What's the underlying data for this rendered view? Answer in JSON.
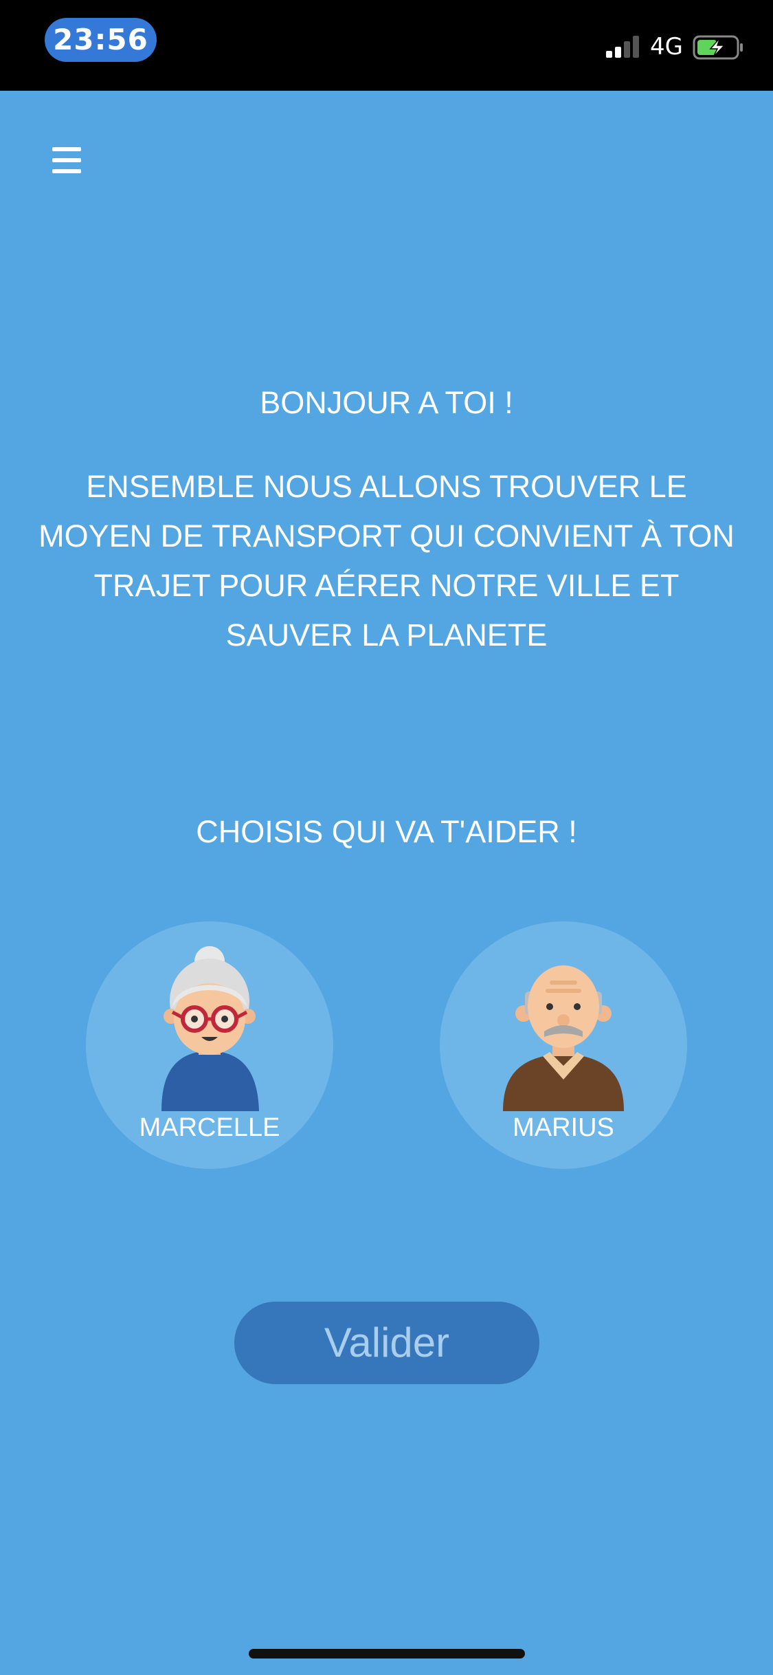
{
  "status_bar": {
    "time": "23:56",
    "network": "4G",
    "icons": [
      "signal-icon",
      "battery-charging-icon"
    ]
  },
  "menu": {
    "icon": "hamburger-menu-icon"
  },
  "main": {
    "greeting": "BONJOUR A TOI !",
    "intro": "ENSEMBLE NOUS ALLONS TROUVER LE MOYEN DE TRANSPORT QUI CONVIENT À TON TRAJET POUR AÉRER NOTRE VILLE ET SAUVER LA PLANETE",
    "choose_prompt": "CHOISIS QUI VA T'AIDER !"
  },
  "assistants": [
    {
      "name": "MARCELLE",
      "icon": "grandmother-avatar-icon"
    },
    {
      "name": "MARIUS",
      "icon": "grandfather-avatar-icon"
    }
  ],
  "actions": {
    "validate_label": "Valider"
  },
  "colors": {
    "background": "#53a6e1",
    "avatar_circle": "#6fb6e8",
    "button": "#3676bb",
    "button_text": "#a9cdef",
    "time_pill": "#3478d8",
    "battery_fill": "#5fd35b"
  }
}
